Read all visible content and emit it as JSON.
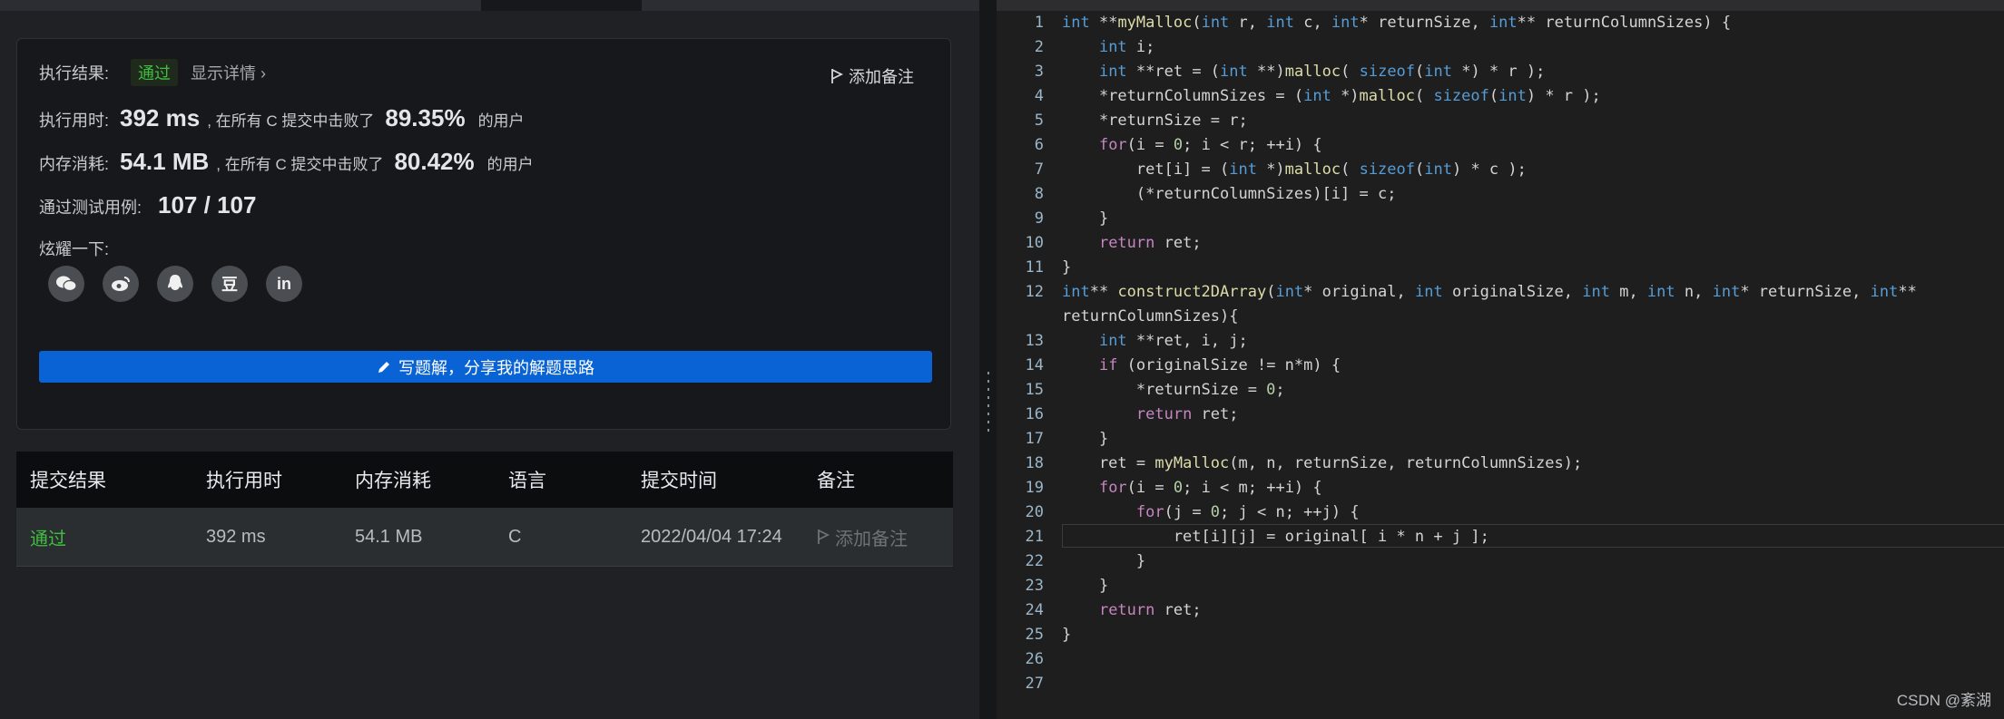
{
  "result": {
    "exec_result_label": "执行结果:",
    "status": "通过",
    "show_details": "显示详情",
    "add_note": "添加备注",
    "time_label": "执行用时:",
    "time_value": "392 ms",
    "time_beat_text": ", 在所有 C 提交中击败了",
    "time_percent": "89.35%",
    "users_suffix": "的用户",
    "memory_label": "内存消耗:",
    "memory_value": "54.1 MB",
    "memory_beat_text": ", 在所有 C 提交中击败了",
    "memory_percent": "80.42%",
    "cases_label": "通过测试用例:",
    "cases_value": "107 / 107",
    "share_label": "炫耀一下:",
    "share_icons": [
      "wechat-icon",
      "weibo-icon",
      "qq-icon",
      "douban-icon",
      "linkedin-icon"
    ],
    "douban_glyph": "豆",
    "linkedin_glyph": "in",
    "write_solution": "写题解，分享我的解题思路"
  },
  "submissions": {
    "columns": [
      "提交结果",
      "执行用时",
      "内存消耗",
      "语言",
      "提交时间",
      "备注"
    ],
    "row": {
      "status": "通过",
      "time": "392 ms",
      "memory": "54.1 MB",
      "language": "C",
      "submitted_at": "2022/04/04 17:24",
      "note": "添加备注"
    }
  },
  "editor": {
    "line_numbers": [
      "1",
      "2",
      "3",
      "4",
      "5",
      "6",
      "7",
      "8",
      "9",
      "10",
      "11",
      "12",
      "13",
      "14",
      "15",
      "16",
      "17",
      "18",
      "19",
      "20",
      "21",
      "22",
      "23",
      "24",
      "25",
      "26",
      "27"
    ],
    "code_lines": [
      "int **myMalloc(int r, int c, int* returnSize, int** returnColumnSizes) {",
      "    int i;",
      "    int **ret = (int **)malloc( sizeof(int *) * r );",
      "    *returnColumnSizes = (int *)malloc( sizeof(int) * r );",
      "    *returnSize = r;",
      "    for(i = 0; i < r; ++i) {",
      "        ret[i] = (int *)malloc( sizeof(int) * c );",
      "        (*returnColumnSizes)[i] = c;",
      "    }",
      "    return ret;",
      "}",
      "int** construct2DArray(int* original, int originalSize, int m, int n, int* returnSize, int**",
      "returnColumnSizes){",
      "    int **ret, i, j;",
      "    if (originalSize != n*m) {",
      "        *returnSize = 0;",
      "        return ret;",
      "    }",
      "    ret = myMalloc(m, n, returnSize, returnColumnSizes);",
      "    for(i = 0; i < m; ++i) {",
      "        for(j = 0; j < n; ++j) {",
      "            ret[i][j] = original[ i * n + j ];",
      "        }",
      "    }",
      "    return ret;",
      "}",
      "",
      ""
    ]
  },
  "watermark": "CSDN @紊湖",
  "colors": {
    "accent": "#0a63d4",
    "success": "#3fbf3f"
  }
}
